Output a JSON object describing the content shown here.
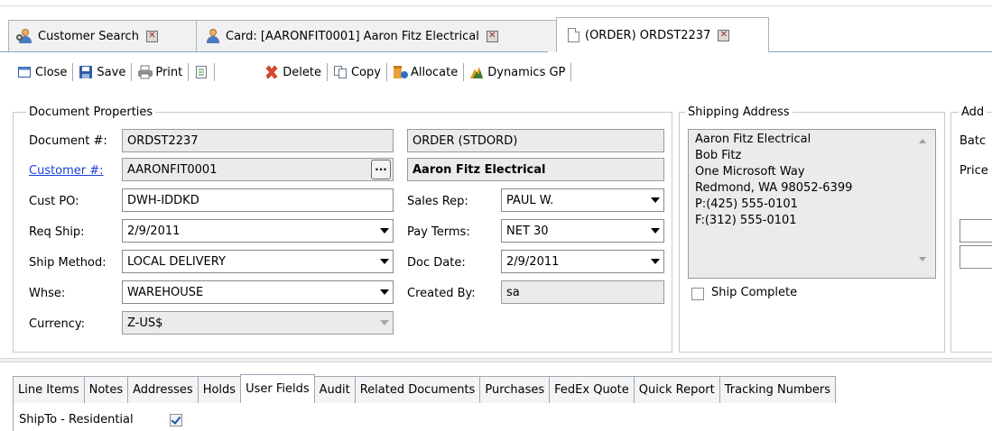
{
  "doc_tabs": [
    {
      "label": "Customer Search",
      "icon": "customer-search-icon",
      "active": false
    },
    {
      "label": "Card: [AARONFIT0001] Aaron Fitz Electrical",
      "icon": "customer-card-icon",
      "active": false
    },
    {
      "label": "(ORDER) ORDST2237",
      "icon": "document-icon",
      "active": true
    }
  ],
  "toolbar": {
    "close": "Close",
    "save": "Save",
    "print": "Print",
    "delete": "Delete",
    "copy": "Copy",
    "allocate": "Allocate",
    "dynamics": "Dynamics GP"
  },
  "doc_props": {
    "title": "Document Properties",
    "document_label": "Document #:",
    "document_value": "ORDST2237",
    "customer_label": "Customer #:",
    "customer_value": "AARONFIT0001",
    "custpo_label": "Cust PO:",
    "custpo_value": "DWH-IDDKD",
    "reqship_label": "Req Ship:",
    "reqship_value": "2/9/2011",
    "shipmethod_label": "Ship Method:",
    "shipmethod_value": "LOCAL DELIVERY",
    "whse_label": "Whse:",
    "whse_value": "WAREHOUSE",
    "currency_label": "Currency:",
    "currency_value": "Z-US$",
    "ellipsis": "···",
    "doctype_value": "ORDER (STDORD)",
    "customer_name": "Aaron Fitz Electrical",
    "salesrep_label": "Sales Rep:",
    "salesrep_value": "PAUL W.",
    "payterms_label": "Pay Terms:",
    "payterms_value": "NET 30",
    "docdate_label": "Doc Date:",
    "docdate_value": "2/9/2011",
    "createdby_label": "Created By:",
    "createdby_value": "sa"
  },
  "shipping": {
    "title": "Shipping Address",
    "lines": [
      "Aaron Fitz Electrical",
      "Bob Fitz",
      "One Microsoft Way",
      "Redmond, WA 98052-6399",
      "P:(425) 555-0101",
      "F:(312) 555-0101"
    ],
    "ship_complete_label": "Ship Complete",
    "ship_complete_checked": false
  },
  "additional": {
    "title": "Add",
    "batch_label": "Batc",
    "price_label": "Price"
  },
  "bottom_tabs": [
    {
      "label": "Line Items",
      "underline": "L"
    },
    {
      "label": "Notes"
    },
    {
      "label": "Addresses"
    },
    {
      "label": "Holds"
    },
    {
      "label": "User Fields",
      "active": true
    },
    {
      "label": "Audit"
    },
    {
      "label": "Related Documents"
    },
    {
      "label": "Purchases"
    },
    {
      "label": "FedEx Quote"
    },
    {
      "label": "Quick Report"
    },
    {
      "label": "Tracking Numbers"
    }
  ],
  "user_fields": {
    "shipto_residential_label": "ShipTo - Residential",
    "shipto_residential_checked": true
  }
}
